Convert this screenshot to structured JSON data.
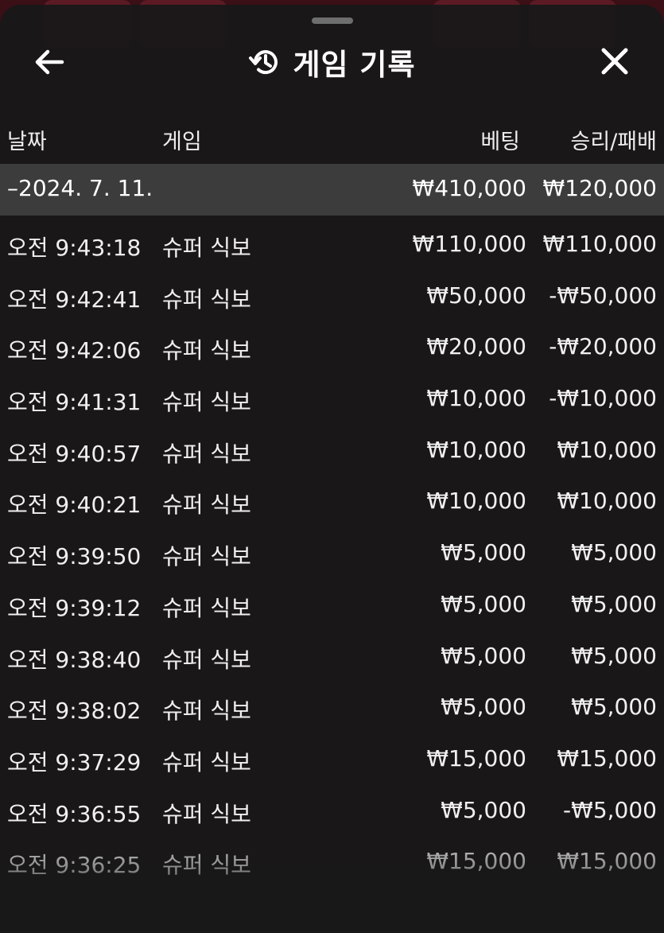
{
  "header": {
    "title": "게임 기록",
    "back_icon": "arrow-left-icon",
    "history_icon": "history-icon",
    "close_icon": "close-icon"
  },
  "columns": {
    "date": "날짜",
    "game": "게임",
    "bet": "베팅",
    "win_loss": "승리/패배"
  },
  "day_summary": {
    "date": "–2024. 7. 11.",
    "bet": "₩410,000",
    "win_loss": "₩120,000"
  },
  "rows": [
    {
      "time": "오전 9:43:18",
      "game": "슈퍼 식보",
      "bet": "₩110,000",
      "win_loss": "₩110,000"
    },
    {
      "time": "오전 9:42:41",
      "game": "슈퍼 식보",
      "bet": "₩50,000",
      "win_loss": "-₩50,000"
    },
    {
      "time": "오전 9:42:06",
      "game": "슈퍼 식보",
      "bet": "₩20,000",
      "win_loss": "-₩20,000"
    },
    {
      "time": "오전 9:41:31",
      "game": "슈퍼 식보",
      "bet": "₩10,000",
      "win_loss": "-₩10,000"
    },
    {
      "time": "오전 9:40:57",
      "game": "슈퍼 식보",
      "bet": "₩10,000",
      "win_loss": "₩10,000"
    },
    {
      "time": "오전 9:40:21",
      "game": "슈퍼 식보",
      "bet": "₩10,000",
      "win_loss": "₩10,000"
    },
    {
      "time": "오전 9:39:50",
      "game": "슈퍼 식보",
      "bet": "₩5,000",
      "win_loss": "₩5,000"
    },
    {
      "time": "오전 9:39:12",
      "game": "슈퍼 식보",
      "bet": "₩5,000",
      "win_loss": "₩5,000"
    },
    {
      "time": "오전 9:38:40",
      "game": "슈퍼 식보",
      "bet": "₩5,000",
      "win_loss": "₩5,000"
    },
    {
      "time": "오전 9:38:02",
      "game": "슈퍼 식보",
      "bet": "₩5,000",
      "win_loss": "₩5,000"
    },
    {
      "time": "오전 9:37:29",
      "game": "슈퍼 식보",
      "bet": "₩15,000",
      "win_loss": "₩15,000"
    },
    {
      "time": "오전 9:36:55",
      "game": "슈퍼 식보",
      "bet": "₩5,000",
      "win_loss": "-₩5,000"
    },
    {
      "time": "오전 9:36:25",
      "game": "슈퍼 식보",
      "bet": "₩15,000",
      "win_loss": "₩15,000"
    }
  ]
}
